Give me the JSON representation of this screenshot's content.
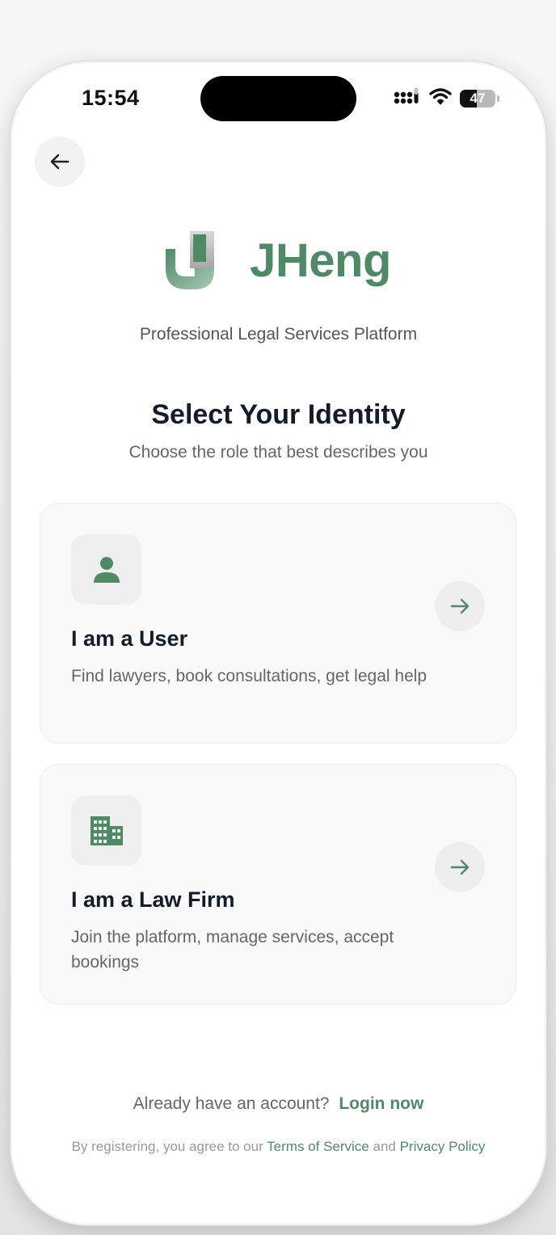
{
  "status_bar": {
    "time": "15:54",
    "battery_level": "47",
    "icons": [
      "signal-icon",
      "wifi-icon",
      "battery-icon"
    ]
  },
  "header": {
    "back_icon": "arrow-left-icon"
  },
  "brand": {
    "name": "JHeng",
    "tagline": "Professional Legal Services Platform",
    "logo_icon": "jheng-logo-icon",
    "color": "#4f8a66"
  },
  "main": {
    "title": "Select Your Identity",
    "subtitle": "Choose the role that best describes you",
    "options": [
      {
        "title": "I am a User",
        "description": "Find lawyers, book consultations, get legal help",
        "icon": "person-icon",
        "action_icon": "arrow-right-icon"
      },
      {
        "title": "I am a Law Firm",
        "description": "Join the platform, manage services, accept bookings",
        "icon": "building-icon",
        "action_icon": "arrow-right-icon"
      }
    ]
  },
  "footer": {
    "account_prompt": "Already have an account?",
    "login_link": "Login now",
    "terms_prefix": "By registering, you agree to our",
    "terms_link": "Terms of Service",
    "terms_and": "and",
    "privacy_link": "Privacy Policy"
  }
}
